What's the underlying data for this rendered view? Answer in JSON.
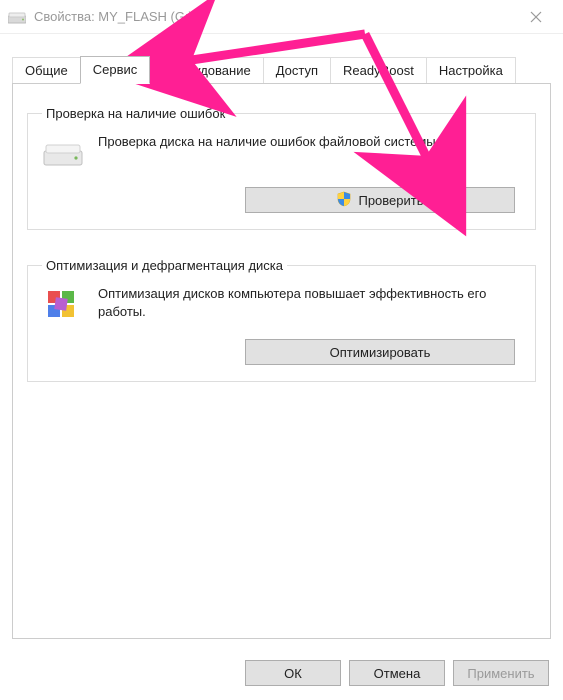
{
  "window": {
    "title": "Свойства: MY_FLASH (G:)"
  },
  "tabs": {
    "t0": "Общие",
    "t1": "Сервис",
    "t2": "Оборудование",
    "t3": "Доступ",
    "t4": "ReadyBoost",
    "t5": "Настройка",
    "active_index": 1
  },
  "group_check": {
    "legend": "Проверка на наличие ошибок",
    "text": "Проверка диска на наличие ошибок файловой системы.",
    "button": "Проверить"
  },
  "group_defrag": {
    "legend": "Оптимизация и дефрагментация диска",
    "text": "Оптимизация дисков компьютера повышает эффективность его работы.",
    "button": "Оптимизировать"
  },
  "buttons": {
    "ok": "ОК",
    "cancel": "Отмена",
    "apply": "Применить"
  },
  "icons": {
    "drive": "drive-icon",
    "shield": "shield-icon",
    "defrag": "defrag-icon",
    "close": "close-icon"
  },
  "annotation": {
    "arrow_color": "#ff1f94"
  }
}
